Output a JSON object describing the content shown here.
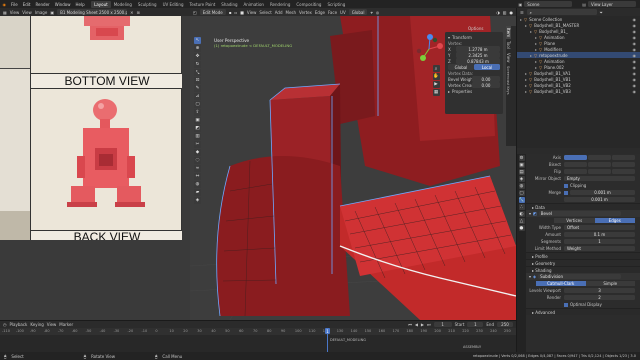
{
  "menus": [
    "File",
    "Edit",
    "Render",
    "Window",
    "Help"
  ],
  "workspaces": [
    "Layout",
    "Modeling",
    "Sculpting",
    "UV Editing",
    "Texture Paint",
    "Shading",
    "Animation",
    "Rendering",
    "Compositing",
    "Scripting"
  ],
  "active_workspace": "Layout",
  "scene_label": "Scene",
  "view_layer_label": "View Layer",
  "image_editor": {
    "menus": [
      "View",
      "View",
      "Image"
    ],
    "image_name": "B1 Modeling Sheet 2500 x 2500.png",
    "top_label": "BOTTOM VIEW",
    "bottom_label": "BACK VIEW"
  },
  "viewport": {
    "mode": "Edit Mode",
    "menus": [
      "View",
      "Select",
      "Add",
      "Mesh",
      "Vertex",
      "Edge",
      "Face",
      "UV"
    ],
    "transform_orientation": "Global",
    "perspective_label": "User Perspective",
    "object_label": "(1) retopoextrude < DEFAULT_MODELING",
    "options_label": "Options",
    "npanel": {
      "title": "Transform",
      "section_label": "Vertex:",
      "x_label": "X",
      "x_value": "1.2778 m",
      "y_label": "Y",
      "y_value": "2.3425 m",
      "z_label": "Z",
      "z_value": "0.87843 m",
      "global_label": "Global",
      "local_label": "Local",
      "data_label": "Vertex Data:",
      "bevel_label": "Bevel Weight",
      "bevel_value": "0.00",
      "crease_label": "Vertex Crease",
      "crease_value": "0.00",
      "properties_label": "Properties",
      "tabs": [
        "Item",
        "Tool",
        "View",
        "Screencast Keys"
      ]
    }
  },
  "outliner": {
    "items": [
      {
        "label": "Scene Collection",
        "indent": 0,
        "selected": false
      },
      {
        "label": "Bodyshell_B1_MASTER",
        "indent": 1,
        "selected": false
      },
      {
        "label": "Bodyshell_B1_",
        "indent": 2,
        "selected": false
      },
      {
        "label": "Animation",
        "indent": 3,
        "selected": false
      },
      {
        "label": "Plane",
        "indent": 3,
        "selected": false
      },
      {
        "label": "Modifiers",
        "indent": 3,
        "selected": false
      },
      {
        "label": "retopoextrude",
        "indent": 2,
        "selected": true
      },
      {
        "label": "Animation",
        "indent": 3,
        "selected": false
      },
      {
        "label": "Plane.002",
        "indent": 3,
        "selected": false
      },
      {
        "label": "Bodyshell_B1_VA1",
        "indent": 1,
        "selected": false
      },
      {
        "label": "Bodyshell_B1_VB1",
        "indent": 1,
        "selected": false
      },
      {
        "label": "Bodyshell_B1_VB2",
        "indent": 1,
        "selected": false
      },
      {
        "label": "Bodyshell_B1_VB3",
        "indent": 1,
        "selected": false
      }
    ]
  },
  "properties": {
    "axis_rows": [
      {
        "label": "Axis"
      },
      {
        "label": "Bisect"
      },
      {
        "label": "Flip"
      }
    ],
    "mirror_object_label": "Mirror Object",
    "mirror_object_value": "Empty",
    "clipping_label": "Clipping",
    "merge_label": "Merge",
    "merge_value": "0.001 m",
    "bisect_distance_value": "0.001 m",
    "data_label": "Data",
    "bevel_modifier": "Bevel",
    "bevel_tabs": [
      "Vertices",
      "Edges"
    ],
    "width_type_label": "Width Type",
    "width_type_value": "Offset",
    "amount_label": "Amount",
    "amount_value": "0.1 m",
    "segments_label": "Segments",
    "segments_value": "1",
    "limit_method_label": "Limit Method",
    "limit_method_value": "Weight",
    "sections": [
      "Profile",
      "Geometry",
      "Shading"
    ],
    "subsurf_modifier": "Subdivision",
    "subsurf_tabs": [
      "Catmull-Clark",
      "Simple"
    ],
    "levels_viewport_label": "Levels Viewport",
    "levels_viewport_value": "3",
    "render_label": "Render",
    "render_value": "2",
    "optimal_display_label": "Optimal Display",
    "advanced_label": "Advanced"
  },
  "timeline": {
    "menus": [
      "Playback",
      "Keying",
      "View",
      "Marker"
    ],
    "ticks": [
      "-110",
      "-100",
      "-90",
      "-80",
      "-70",
      "-60",
      "-50",
      "-40",
      "-30",
      "-20",
      "-10",
      "0",
      "10",
      "20",
      "30",
      "40",
      "50",
      "60",
      "70",
      "80",
      "90",
      "100",
      "110",
      "120",
      "130",
      "140",
      "150",
      "160",
      "170",
      "180",
      "190",
      "200",
      "210",
      "220",
      "230",
      "240",
      "250"
    ],
    "current_frame": "1",
    "start_label": "Start",
    "start_value": "1",
    "end_label": "End",
    "end_value": "250",
    "object_label": "DEFAULT_MODELING",
    "assembly_label": "ASSEMBLY"
  },
  "status": {
    "left": "Select",
    "mid1": "Rotate View",
    "mid2": "Call Menu",
    "right": "retopoextrude | Verts 0/2,068 | Edges 0/4,087 | Faces 0/947 | Tris 0/2,124 | Objects 1/23 | 3.0"
  },
  "colors": {
    "model_red": "#c22a2a",
    "selection_blue": "#4a6fb5",
    "header": "#2b2b2b"
  }
}
